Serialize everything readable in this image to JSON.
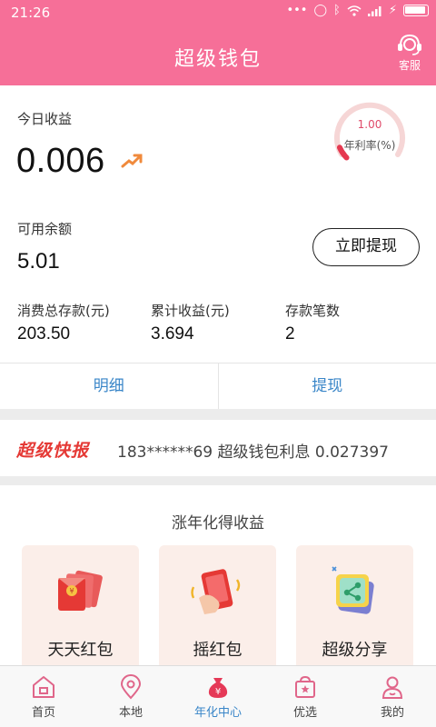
{
  "status": {
    "time": "21:26"
  },
  "header": {
    "title": "超级钱包",
    "service_label": "客服"
  },
  "today": {
    "label": "今日收益",
    "value": "0.006"
  },
  "rate": {
    "value": "1.00",
    "label": "年利率(%)",
    "level": 0.08
  },
  "balance": {
    "label": "可用余额",
    "value": "5.01",
    "withdraw_button": "立即提现"
  },
  "stats": [
    {
      "label": "消费总存款(元)",
      "value": "203.50"
    },
    {
      "label": "累计收益(元)",
      "value": "3.694"
    },
    {
      "label": "存款笔数",
      "value": "2"
    }
  ],
  "tabs": [
    {
      "label": "明细"
    },
    {
      "label": "提现"
    }
  ],
  "news": {
    "badge": "超级快报",
    "text": "183******69 超级钱包利息 0.027397"
  },
  "earn": {
    "title": "涨年化得收益",
    "tiles": [
      {
        "label": "天天红包",
        "icon": "red-envelope-icon"
      },
      {
        "label": "摇红包",
        "icon": "shake-phone-icon"
      },
      {
        "label": "超级分享",
        "icon": "share-icon"
      }
    ]
  },
  "nav": [
    {
      "label": "首页",
      "icon": "home-icon",
      "active": false
    },
    {
      "label": "本地",
      "icon": "location-icon",
      "active": false
    },
    {
      "label": "年化中心",
      "icon": "money-bag-icon",
      "active": true
    },
    {
      "label": "优选",
      "icon": "shopping-bag-icon",
      "active": false
    },
    {
      "label": "我的",
      "icon": "user-icon",
      "active": false
    }
  ],
  "colors": {
    "brand": "#f66f98",
    "accent_blue": "#3a86c8",
    "news_red": "#e53935"
  }
}
